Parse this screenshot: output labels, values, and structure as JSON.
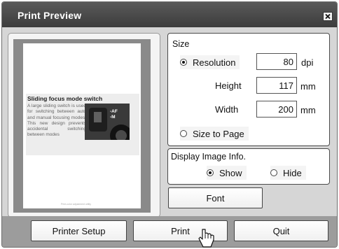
{
  "window": {
    "title": "Print Preview"
  },
  "preview": {
    "heading": "Sliding focus mode switch",
    "body": "A large sliding switch is used for switching between auto and manual focusing modes. This new design prevents accidental switching between modes",
    "photo_labels": "-AF\n-M",
    "footer": "Print-color adjustment utility"
  },
  "size_group": {
    "label": "Size",
    "resolution": {
      "label": "Resolution",
      "value": "80",
      "unit": "dpi",
      "selected": true
    },
    "height": {
      "label": "Height",
      "value": "117",
      "unit": "mm"
    },
    "width": {
      "label": "Width",
      "value": "200",
      "unit": "mm"
    },
    "size_to_page": {
      "label": "Size to Page",
      "selected": false
    }
  },
  "info_group": {
    "label": "Display Image Info.",
    "show": {
      "label": "Show",
      "selected": true
    },
    "hide": {
      "label": "Hide",
      "selected": false
    }
  },
  "buttons": {
    "font": "Font",
    "printer_setup": "Printer Setup",
    "print": "Print",
    "quit": "Quit"
  },
  "icons": {
    "close": "close-icon",
    "cursor": "mouse-pointer-icon"
  }
}
